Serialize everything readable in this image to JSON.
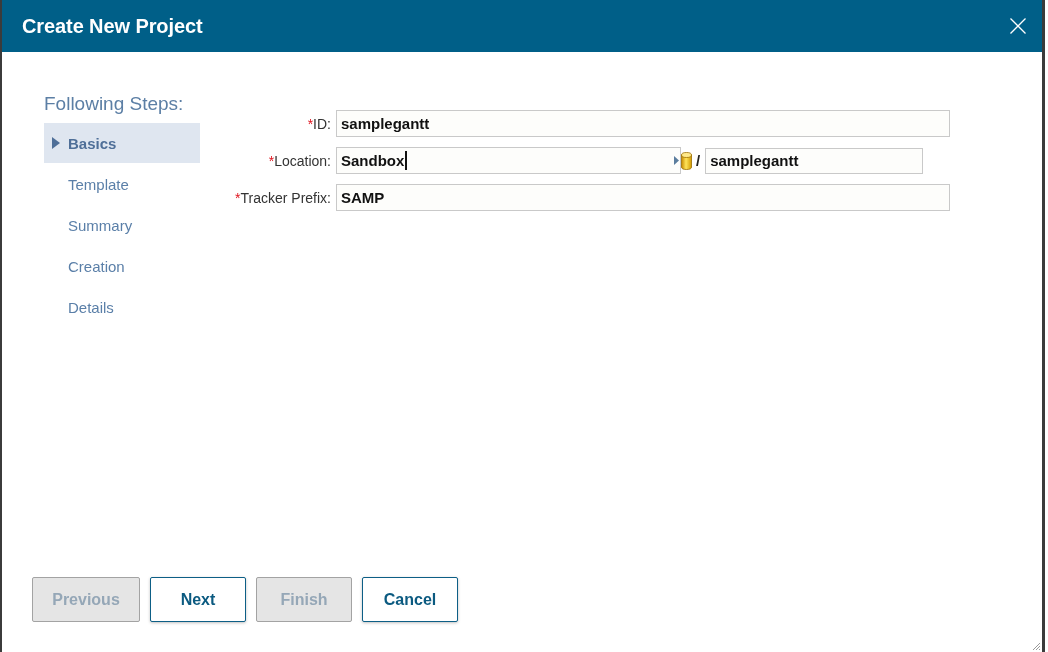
{
  "window": {
    "title": "Create New Project"
  },
  "sidebar": {
    "heading": "Following Steps:",
    "items": [
      {
        "label": "Basics",
        "selected": true
      },
      {
        "label": "Template",
        "selected": false
      },
      {
        "label": "Summary",
        "selected": false
      },
      {
        "label": "Creation",
        "selected": false
      },
      {
        "label": "Details",
        "selected": false
      }
    ]
  },
  "form": {
    "fields": [
      {
        "kind": "text",
        "required_mark": "*",
        "label": "ID:",
        "value": "samplegantt",
        "focused": false
      },
      {
        "kind": "location",
        "required_mark": "*",
        "label": "Location:",
        "value": "Sandbox",
        "focused": true,
        "separator": "/",
        "path_value": "samplegantt"
      },
      {
        "kind": "text",
        "required_mark": "*",
        "label": "Tracker Prefix:",
        "value": "SAMP",
        "focused": false
      }
    ]
  },
  "buttons": [
    {
      "label": "Previous",
      "disabled": true
    },
    {
      "label": "Next",
      "disabled": false
    },
    {
      "label": "Finish",
      "disabled": true
    },
    {
      "label": "Cancel",
      "disabled": false
    }
  ]
}
